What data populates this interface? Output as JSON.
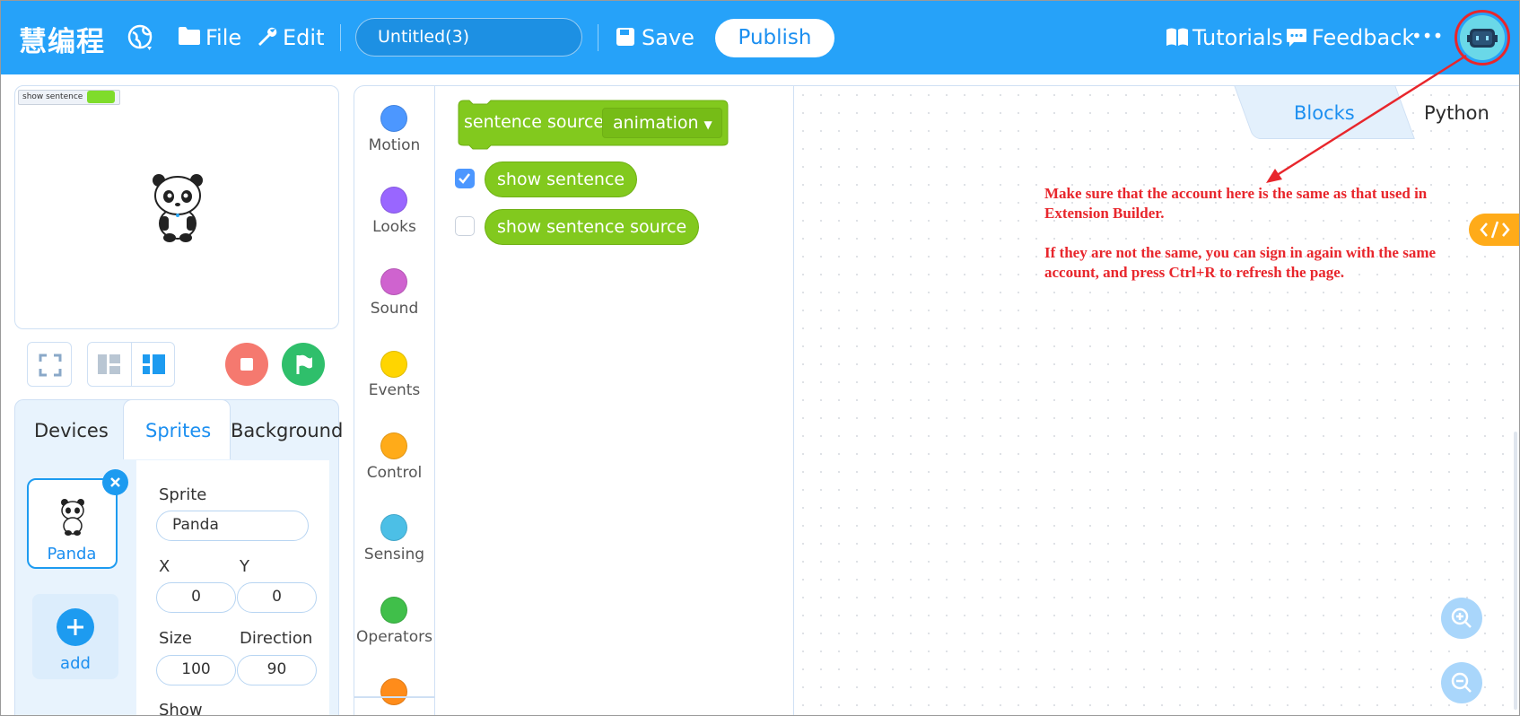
{
  "topbar": {
    "logo": "慧编程",
    "file_label": "File",
    "edit_label": "Edit",
    "project_name": "Untitled(3)",
    "save_label": "Save",
    "publish_label": "Publish",
    "tutorials_label": "Tutorials",
    "feedback_label": "Feedback",
    "more_label": "•••"
  },
  "stage": {
    "monitor_label": "show sentence"
  },
  "tabs": [
    "Devices",
    "Sprites",
    "Background"
  ],
  "sprite": {
    "thumb_name": "Panda",
    "add_label": "add",
    "sprite_label": "Sprite",
    "name": "Panda",
    "x_label": "X",
    "y_label": "Y",
    "x": "0",
    "y": "0",
    "size_label": "Size",
    "direction_label": "Direction",
    "size": "100",
    "direction": "90",
    "show_label": "Show"
  },
  "categories": [
    {
      "label": "Motion",
      "color": "#4c97ff"
    },
    {
      "label": "Looks",
      "color": "#9966ff"
    },
    {
      "label": "Sound",
      "color": "#cf63cf"
    },
    {
      "label": "Events",
      "color": "#ffd500"
    },
    {
      "label": "Control",
      "color": "#ffab19"
    },
    {
      "label": "Sensing",
      "color": "#4cbfe6"
    },
    {
      "label": "Operators",
      "color": "#40bf4a"
    }
  ],
  "blocks": {
    "hat_label": "sentence source",
    "hat_dropdown": "animation",
    "reporter1": "show sentence",
    "reporter1_checked": true,
    "reporter2": "show sentence source",
    "reporter2_checked": false
  },
  "workspace": {
    "tab_blocks": "Blocks",
    "tab_python": "Python",
    "note_line1": "Make sure that the account here is the same as that used in Extension Builder.",
    "note_line2": "If they are not the same, you can sign in again with the same account, and press Ctrl+R to refresh the page."
  },
  "colors": {
    "topbar": "#26a2f9",
    "block_green": "#82c91e",
    "annotation_red": "#e8262c",
    "stop": "#f5796f",
    "go": "#2fbf6b"
  }
}
